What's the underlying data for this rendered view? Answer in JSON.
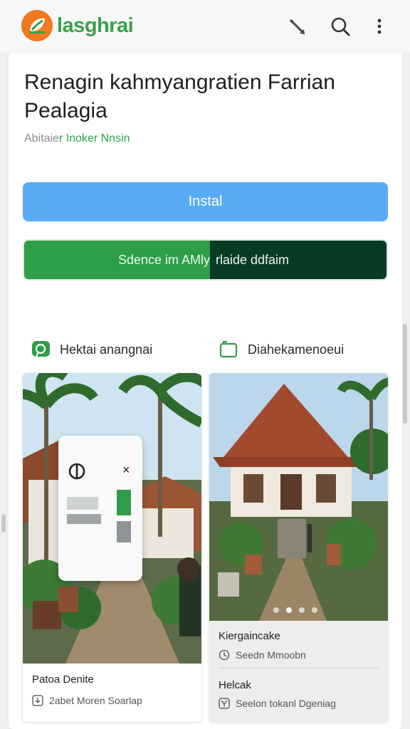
{
  "app_bar": {
    "brand_name": "lasghrai",
    "logo_icon": "leaf-logo-icon",
    "actions": [
      {
        "name": "edit-icon"
      },
      {
        "name": "search-icon"
      },
      {
        "name": "more-vert-icon"
      }
    ],
    "brand_color": "#3aa04a",
    "logo_color": "#f07a1f"
  },
  "hero": {
    "title": "Renagin kahmyangratien Farrian Pealagia",
    "subtitle_prefix": "Abitaie",
    "subtitle_highlight": "r Inoker Nnsin"
  },
  "buttons": {
    "install_label": "Instal",
    "split_left_label": "Sdence im AMly",
    "split_right_label": "rlaide ddfaim",
    "install_color": "#59aaf5",
    "split_left_color": "#2e9e48",
    "split_right_color": "#073b26"
  },
  "sections": [
    {
      "label": "Hektai anangnai",
      "icon": "chat-bubble-icon"
    },
    {
      "label": "Diahekamenoeui",
      "icon": "folder-icon"
    }
  ],
  "cards": [
    {
      "caption_title": "Patoa Denite",
      "meta": "2abet Moren Soarlap",
      "meta_icon": "download-icon"
    },
    {
      "caption_title": "Kiergaincake",
      "meta": "Seedn Mmoobn",
      "meta_icon": "clock-icon",
      "caption_title_2": "Helcak",
      "meta_2": "Seelon tokanl Dgeniag",
      "meta_icon_2": "filter-icon"
    }
  ],
  "carousel": {
    "page_count": 4,
    "active_index": 1
  },
  "overlay_card": {
    "close_symbol": "×"
  }
}
